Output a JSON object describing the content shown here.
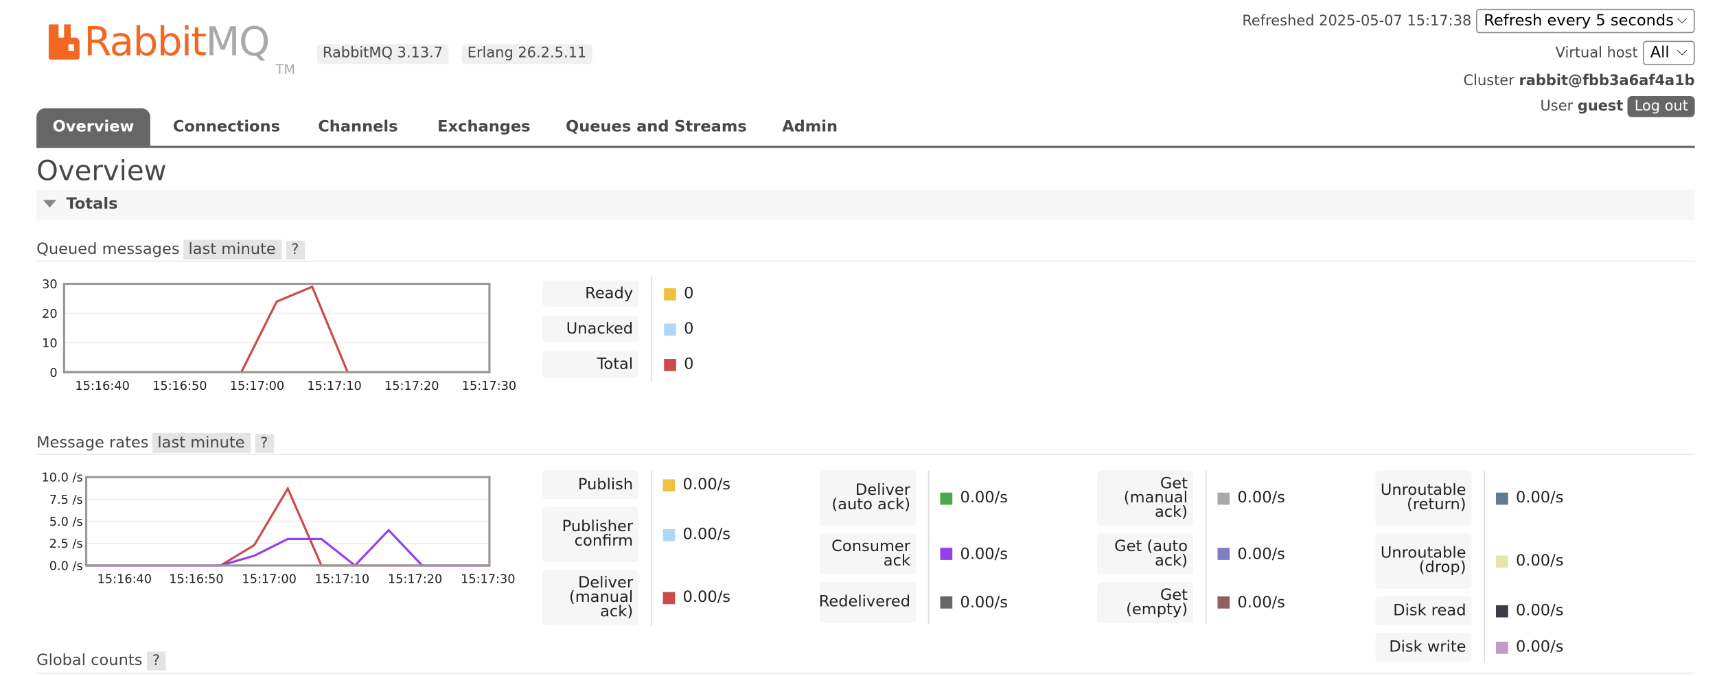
{
  "header": {
    "logo_rabbit": "Rabbit",
    "logo_mq": "MQ",
    "logo_tm": "TM",
    "rabbitmq_version": "RabbitMQ 3.13.7",
    "erlang_version": "Erlang 26.2.5.11",
    "refreshed_label": "Refreshed",
    "refreshed_time": "2025-05-07 15:17:38",
    "refresh_select": "Refresh every 5 seconds",
    "vhost_label": "Virtual host",
    "vhost_select": "All",
    "cluster_label": "Cluster",
    "cluster_name": "rabbit@fbb3a6af4a1b",
    "user_label": "User",
    "user_name": "guest",
    "logout": "Log out"
  },
  "tabs": [
    "Overview",
    "Connections",
    "Channels",
    "Exchanges",
    "Queues and Streams",
    "Admin"
  ],
  "page_title": "Overview",
  "totals": {
    "section_label": "Totals",
    "queued_label": "Queued messages",
    "queued_range": "last minute",
    "help": "?",
    "rates_label": "Message rates",
    "rates_range": "last minute",
    "global_label": "Global counts"
  },
  "queued_legend": [
    {
      "label": "Ready",
      "value": "0",
      "color": "#edc240"
    },
    {
      "label": "Unacked",
      "value": "0",
      "color": "#afd8f8"
    },
    {
      "label": "Total",
      "value": "0",
      "color": "#cb4b4b"
    }
  ],
  "rates_legend": [
    [
      {
        "label": "Publish",
        "value": "0.00/s",
        "color": "#edc240"
      },
      {
        "label": "Publisher confirm",
        "value": "0.00/s",
        "color": "#afd8f8"
      },
      {
        "label": "Deliver (manual ack)",
        "value": "0.00/s",
        "color": "#cb4b4b"
      }
    ],
    [
      {
        "label": "Deliver (auto ack)",
        "value": "0.00/s",
        "color": "#4da74d"
      },
      {
        "label": "Consumer ack",
        "value": "0.00/s",
        "color": "#9440ed"
      },
      {
        "label": "Redelivered",
        "value": "0.00/s",
        "color": "#666666"
      }
    ],
    [
      {
        "label": "Get (manual ack)",
        "value": "0.00/s",
        "color": "#a9a9a9"
      },
      {
        "label": "Get (auto ack)",
        "value": "0.00/s",
        "color": "#7e7ec7"
      },
      {
        "label": "Get (empty)",
        "value": "0.00/s",
        "color": "#936060"
      }
    ],
    [
      {
        "label": "Unroutable (return)",
        "value": "0.00/s",
        "color": "#607b8b"
      },
      {
        "label": "Unroutable (drop)",
        "value": "0.00/s",
        "color": "#e6e6a8"
      },
      {
        "label": "Disk read",
        "value": "0.00/s",
        "color": "#3c3c46"
      },
      {
        "label": "Disk write",
        "value": "0.00/s",
        "color": "#c29ac9"
      }
    ]
  ],
  "chart_data": [
    {
      "type": "line",
      "title": "Queued messages",
      "x": [
        "15:16:38",
        "15:16:43",
        "15:16:48",
        "15:16:53",
        "15:16:58",
        "15:17:03",
        "15:17:08",
        "15:17:13",
        "15:17:18",
        "15:17:23",
        "15:17:28",
        "15:17:33",
        "15:17:38"
      ],
      "xticks": [
        "15:16:40",
        "15:16:50",
        "15:17:00",
        "15:17:10",
        "15:17:20",
        "15:17:30"
      ],
      "yticks": [
        "0",
        "10",
        "20",
        "30"
      ],
      "ylim": [
        0,
        30
      ],
      "series": [
        {
          "name": "Ready",
          "color": "#edc240",
          "values": [
            0,
            0,
            0,
            0,
            0,
            0,
            0,
            0,
            0,
            0,
            0,
            0,
            0
          ]
        },
        {
          "name": "Total",
          "color": "#cb4b4b",
          "values": [
            0,
            0,
            0,
            0,
            0,
            0,
            24,
            29,
            0,
            0,
            0,
            0,
            0
          ]
        }
      ]
    },
    {
      "type": "line",
      "title": "Message rates",
      "x": [
        "15:16:38",
        "15:16:43",
        "15:16:48",
        "15:16:53",
        "15:16:58",
        "15:17:03",
        "15:17:08",
        "15:17:13",
        "15:17:18",
        "15:17:23",
        "15:17:28",
        "15:17:33",
        "15:17:38"
      ],
      "xticks": [
        "15:16:40",
        "15:16:50",
        "15:17:00",
        "15:17:10",
        "15:17:20",
        "15:17:30"
      ],
      "yticks": [
        "0.0 /s",
        "2.5 /s",
        "5.0 /s",
        "7.5 /s",
        "10.0 /s"
      ],
      "ylim": [
        0,
        10
      ],
      "series": [
        {
          "name": "Deliver (manual ack)",
          "color": "#cb4b4b",
          "values": [
            0,
            0,
            0,
            0,
            0,
            0,
            0,
            0,
            0,
            0,
            0,
            0,
            0
          ],
          "overrides": [
            [
              4,
              0
            ],
            [
              5,
              2.3
            ],
            [
              6,
              8.7
            ],
            [
              7,
              0
            ]
          ]
        },
        {
          "name": "Consumer ack",
          "color": "#9440ed",
          "values": [
            0,
            0,
            0,
            0,
            0,
            0,
            0,
            0,
            0,
            0,
            0,
            0,
            0
          ],
          "overrides": [
            [
              4,
              0
            ],
            [
              5,
              1.1
            ],
            [
              6,
              3
            ],
            [
              7,
              3
            ],
            [
              8,
              0
            ],
            [
              9,
              4
            ],
            [
              10,
              0
            ]
          ]
        }
      ]
    }
  ]
}
